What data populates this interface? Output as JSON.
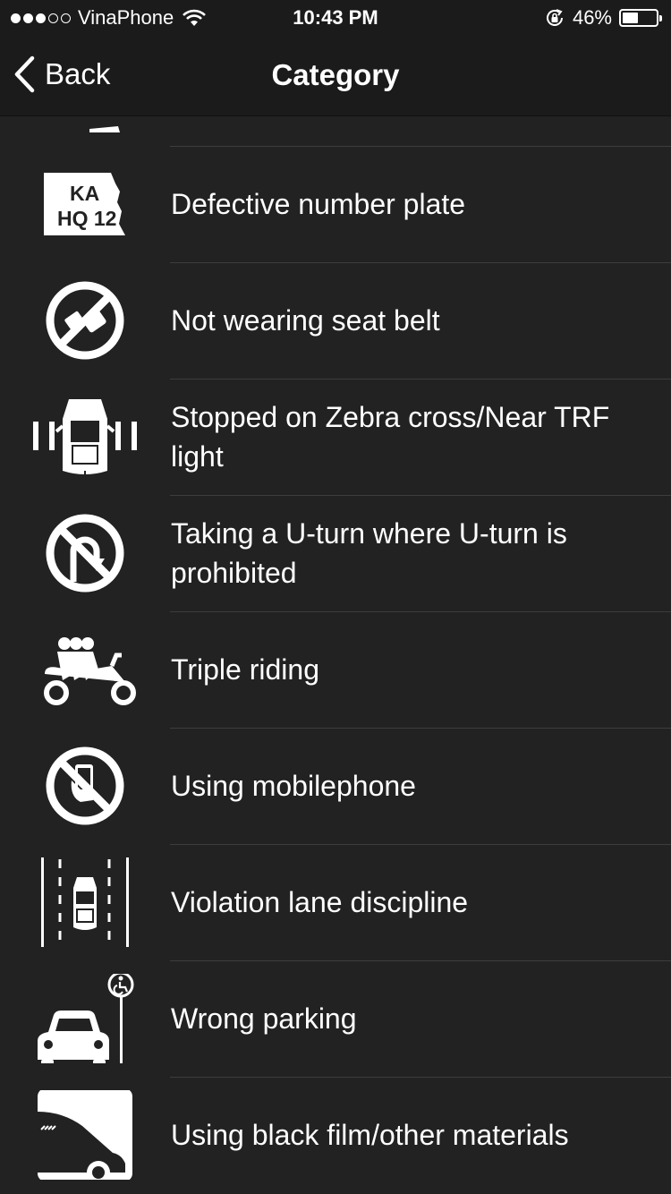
{
  "status_bar": {
    "carrier": "VinaPhone",
    "signal_dots_filled": 3,
    "signal_dots_total": 5,
    "time": "10:43 PM",
    "battery_percent_label": "46%",
    "battery_level": 0.46
  },
  "nav": {
    "back_label": "Back",
    "title": "Category"
  },
  "categories": [
    {
      "label": "Defective number plate",
      "icon": "number-plate-icon"
    },
    {
      "label": "Not wearing seat belt",
      "icon": "no-seat-belt-icon"
    },
    {
      "label": "Stopped on Zebra cross/Near TRF light",
      "icon": "zebra-cross-icon"
    },
    {
      "label": "Taking a U-turn where U-turn is prohibited",
      "icon": "no-u-turn-icon"
    },
    {
      "label": "Triple riding",
      "icon": "triple-riding-icon"
    },
    {
      "label": "Using mobilephone",
      "icon": "no-mobile-phone-icon"
    },
    {
      "label": "Violation lane discipline",
      "icon": "lane-discipline-icon"
    },
    {
      "label": "Wrong parking",
      "icon": "wrong-parking-icon"
    },
    {
      "label": "Using black film/other materials",
      "icon": "black-film-icon"
    }
  ],
  "plate_text": {
    "line1": "KA",
    "line2": "HQ 12"
  },
  "colors": {
    "background": "#222222",
    "bar_background": "#1b1b1b",
    "separator": "#3d3d3d",
    "text": "#ffffff"
  }
}
